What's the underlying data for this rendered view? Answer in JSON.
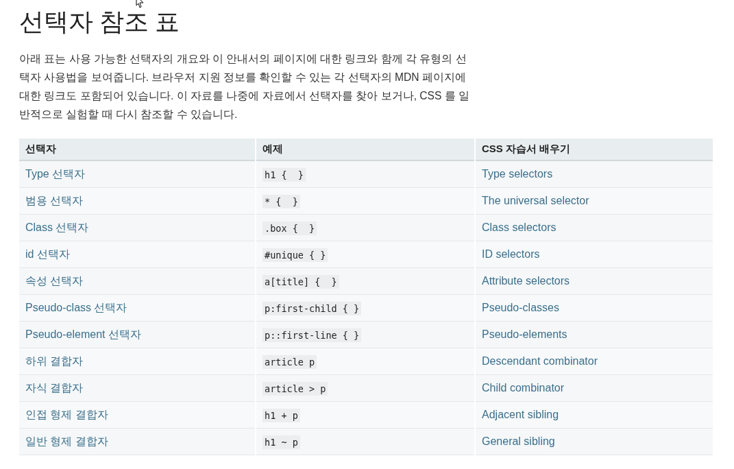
{
  "title": "선택자 참조 표",
  "intro": "아래 표는 사용 가능한 선택자의 개요와 이 안내서의 페이지에 대한 링크와 함께 각 유형의 선택자 사용법을 보여줍니다. 브라우저 지원 정보를 확인할 수 있는 각 선택자의 MDN 페이지에 대한 링크도 포함되어 있습니다. 이 자료를 나중에 자료에서 선택자를 찾아 보거나, CSS 를 일반적으로 실험할 때 다시 참조할 수 있습니다.",
  "table": {
    "columns": [
      "선택자",
      "예제",
      "CSS 자습서 배우기"
    ],
    "rows": [
      {
        "selector": "Type 선택자",
        "example": "h1 {  }",
        "tutorial": "Type selectors"
      },
      {
        "selector": "범용 선택자",
        "example": "* {  }",
        "tutorial": "The universal selector"
      },
      {
        "selector": "Class 선택자",
        "example": ".box {  }",
        "tutorial": "Class selectors"
      },
      {
        "selector": "id 선택자",
        "example": "#unique { }",
        "tutorial": "ID selectors"
      },
      {
        "selector": "속성 선택자",
        "example": "a[title] {  }",
        "tutorial": "Attribute selectors"
      },
      {
        "selector": "Pseudo-class 선택자",
        "example": "p:first-child { }",
        "tutorial": "Pseudo-classes"
      },
      {
        "selector": "Pseudo-element 선택자",
        "example": "p::first-line { }",
        "tutorial": "Pseudo-elements"
      },
      {
        "selector": "하위 결합자",
        "example": "article p",
        "tutorial": "Descendant combinator"
      },
      {
        "selector": "자식 결합자",
        "example": "article > p",
        "tutorial": "Child combinator"
      },
      {
        "selector": "인접 형제 결합자",
        "example": "h1 + p",
        "tutorial": "Adjacent sibling"
      },
      {
        "selector": "일반 형제 결합자",
        "example": "h1 ~ p",
        "tutorial": "General sibling"
      }
    ]
  }
}
